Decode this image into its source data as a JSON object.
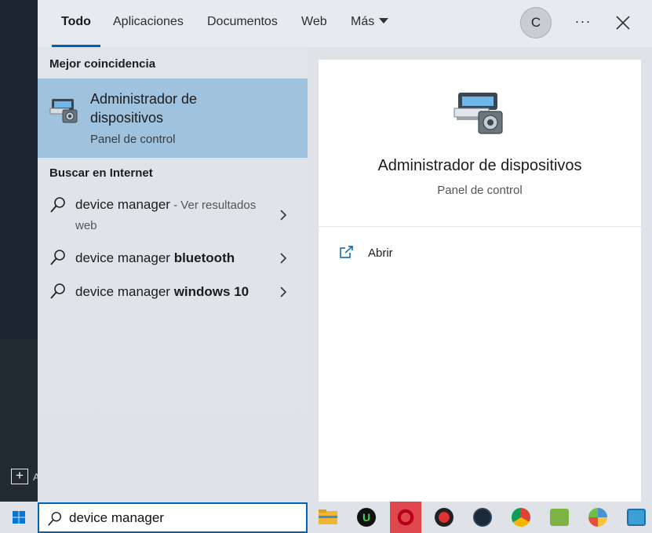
{
  "tabs": [
    {
      "label": "Todo",
      "active": true
    },
    {
      "label": "Aplicaciones",
      "active": false
    },
    {
      "label": "Documentos",
      "active": false
    },
    {
      "label": "Web",
      "active": false
    },
    {
      "label": "Más",
      "active": false
    }
  ],
  "header": {
    "avatar_initial": "C",
    "more_label": "···"
  },
  "results": {
    "best_match_heading": "Mejor coincidencia",
    "best_match": {
      "title": "Administrador de dispositivos",
      "subtitle": "Panel de control"
    },
    "web_heading": "Buscar en Internet",
    "web_items": [
      {
        "query": "device manager",
        "bold": "",
        "suffix": " - Ver resultados web"
      },
      {
        "query": "device manager ",
        "bold": "bluetooth",
        "suffix": ""
      },
      {
        "query": "device manager ",
        "bold": "windows 10",
        "suffix": ""
      }
    ]
  },
  "detail": {
    "title": "Administrador de dispositivos",
    "subtitle": "Panel de control",
    "open_label": "Abrir"
  },
  "search": {
    "value": "device manager"
  },
  "colors": {
    "accent": "#0063b1",
    "selection": "#9fc3df"
  },
  "taskbar_apps": [
    {
      "icon": "file-explorer-icon"
    },
    {
      "icon": "upwork-icon"
    },
    {
      "icon": "opera-icon"
    },
    {
      "icon": "security-shield-icon"
    },
    {
      "icon": "steam-icon"
    },
    {
      "icon": "chrome-icon"
    },
    {
      "icon": "android-app-icon"
    },
    {
      "icon": "paint-icon"
    },
    {
      "icon": "control-panel-icon"
    }
  ]
}
